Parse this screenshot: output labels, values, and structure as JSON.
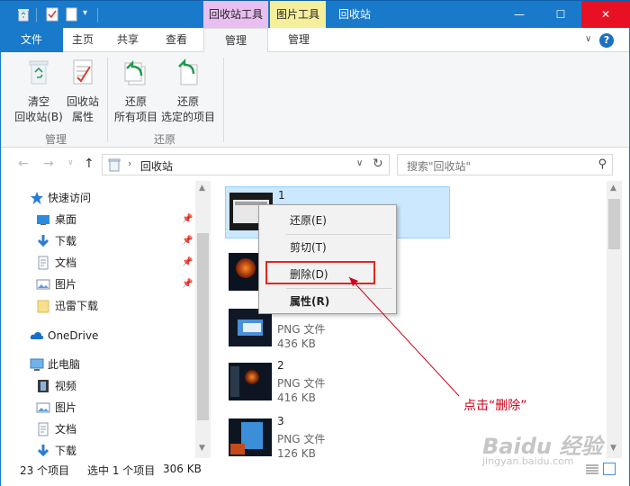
{
  "window": {
    "title": "回收站",
    "context_tab_headers": [
      "回收站工具",
      "图片工具"
    ],
    "min_glyph": "—",
    "max_glyph": "☐",
    "close_glyph": "✕"
  },
  "ribbon_tabs": {
    "file": "文件",
    "home": "主页",
    "share": "共享",
    "view": "查看",
    "manage1": "管理",
    "manage2": "管理"
  },
  "help_glyph": "?",
  "ribbon": {
    "buttons": [
      {
        "line1": "清空",
        "line2": "回收站(B)",
        "icon": "empty-recycle-bin-icon"
      },
      {
        "line1": "回收站",
        "line2": "属性",
        "icon": "recycle-bin-properties-icon"
      },
      {
        "line1": "还原",
        "line2": "所有项目",
        "icon": "restore-all-icon"
      },
      {
        "line1": "还原",
        "line2": "选定的项目",
        "icon": "restore-selected-icon"
      }
    ],
    "groups": [
      "管理",
      "还原"
    ]
  },
  "address": {
    "path": "回收站",
    "search_placeholder": "搜索\"回收站\""
  },
  "nav_pane": {
    "items": [
      {
        "label": "快速访问",
        "icon": "star-icon",
        "pinned": false
      },
      {
        "label": "桌面",
        "icon": "desktop-icon",
        "pinned": true
      },
      {
        "label": "下载",
        "icon": "download-icon",
        "pinned": true
      },
      {
        "label": "文档",
        "icon": "document-icon",
        "pinned": true
      },
      {
        "label": "图片",
        "icon": "picture-icon",
        "pinned": true
      },
      {
        "label": "迅雷下载",
        "icon": "folder-icon",
        "pinned": false
      },
      {
        "label": "OneDrive",
        "icon": "cloud-icon",
        "pinned": false
      },
      {
        "label": "此电脑",
        "icon": "computer-icon",
        "pinned": false
      },
      {
        "label": "视频",
        "icon": "video-icon",
        "pinned": false
      },
      {
        "label": "图片",
        "icon": "picture-icon",
        "pinned": false
      },
      {
        "label": "文档",
        "icon": "document-icon",
        "pinned": false
      },
      {
        "label": "下载",
        "icon": "download-icon",
        "pinned": false
      }
    ]
  },
  "files": [
    {
      "name": "1",
      "type": "",
      "size": "",
      "selected": true
    },
    {
      "name": "",
      "type": "",
      "size": "",
      "selected": false
    },
    {
      "name": "",
      "type": "PNG 文件",
      "size": "436 KB",
      "selected": false
    },
    {
      "name": "2",
      "type": "PNG 文件",
      "size": "416 KB",
      "selected": false
    },
    {
      "name": "3",
      "type": "PNG 文件",
      "size": "126 KB",
      "selected": false
    }
  ],
  "context_menu": {
    "restore": "还原(E)",
    "cut": "剪切(T)",
    "delete": "删除(D)",
    "properties": "属性(R)"
  },
  "annotation": "点击“删除”",
  "status": {
    "count": "23 个项目",
    "selected": "选中 1 个项目",
    "size": "306 KB"
  },
  "watermark": {
    "logo": "Baidu 经验",
    "url": "jingyan.baidu.com"
  },
  "colors": {
    "titlebar": "#1979ca",
    "close": "#e81123",
    "selection": "#cce8ff",
    "annotation": "#d0021b"
  }
}
